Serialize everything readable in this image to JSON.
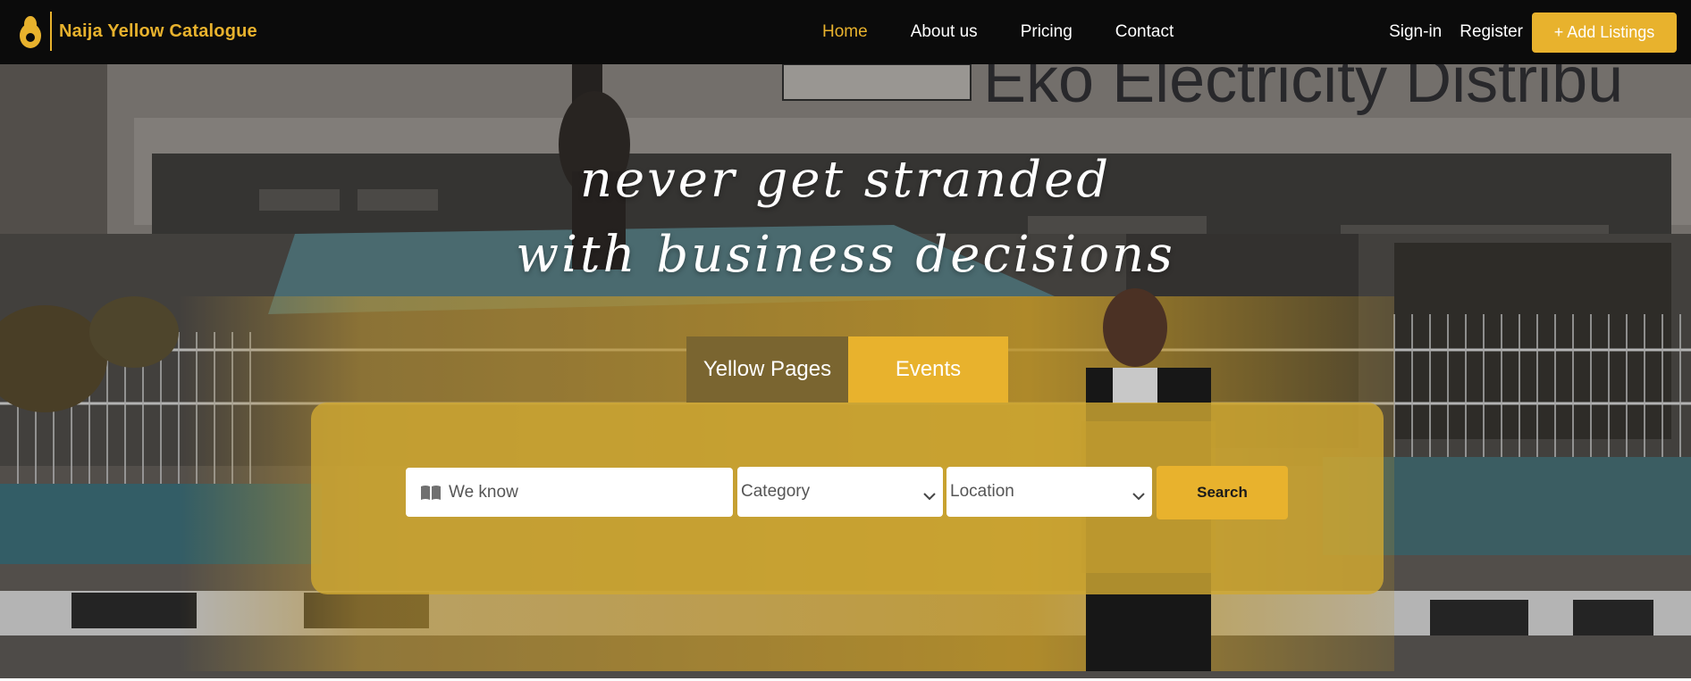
{
  "brand": {
    "name": "Naija Yellow Catalogue",
    "accent_color": "#e8b22d"
  },
  "nav": {
    "items": [
      {
        "label": "Home",
        "active": true
      },
      {
        "label": "About us",
        "active": false
      },
      {
        "label": "Pricing",
        "active": false
      },
      {
        "label": "Contact",
        "active": false
      }
    ]
  },
  "auth": {
    "signin": "Sign-in",
    "register": "Register",
    "add_listing": "+ Add Listings"
  },
  "hero": {
    "headline_line1": "never get stranded",
    "headline_line2": "with business decisions",
    "background_sign_text": "Eko Electricity Distribu"
  },
  "tabs": {
    "yellow_pages": "Yellow Pages",
    "events": "Events"
  },
  "search": {
    "keyword_placeholder": "We know",
    "category_selected": "Category",
    "location_selected": "Location",
    "button": "Search"
  },
  "icons": {
    "logo": "avocado-logo-icon",
    "book": "book-icon",
    "chevron": "chevron-down-icon"
  }
}
